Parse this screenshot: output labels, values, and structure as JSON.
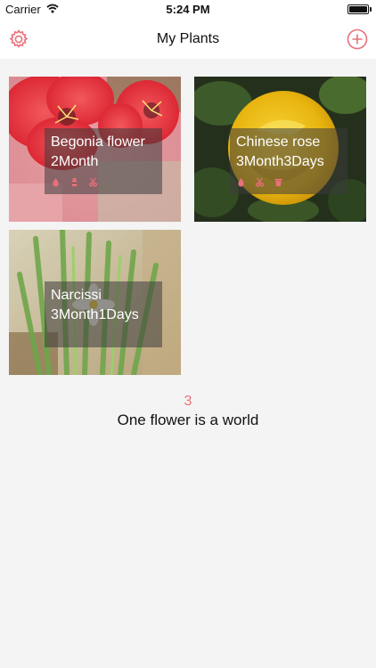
{
  "status_bar": {
    "carrier": "Carrier",
    "time": "5:24 PM",
    "battery_level": 1.0
  },
  "nav": {
    "title": "My Plants",
    "left_icon": "gear-icon",
    "right_icon": "plus-circle-icon"
  },
  "plants": [
    {
      "name": "Begonia flower",
      "age": "2Month",
      "icons": [
        "water-drop-icon",
        "fertilizer-icon",
        "scissors-icon"
      ]
    },
    {
      "name": "Chinese rose",
      "age": "3Month3Days",
      "icons": [
        "water-drop-icon",
        "scissors-icon",
        "pot-icon"
      ]
    },
    {
      "name": "Narcissi",
      "age": "3Month1Days",
      "icons": []
    }
  ],
  "footer": {
    "count": "3",
    "slogan": "One flower is a world"
  },
  "colors": {
    "accent": "#e8707a",
    "background": "#f4f4f4",
    "overlay": "#3c3c3c"
  }
}
